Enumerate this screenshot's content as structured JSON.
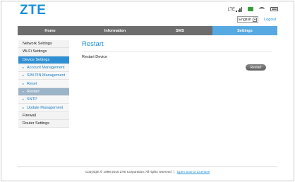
{
  "header": {
    "logo": "ZTE",
    "network_type": "LTE",
    "icons": [
      "signal-icon",
      "sms-icon",
      "wifi-icon",
      "battery-icon"
    ]
  },
  "lang": {
    "selected": "English",
    "logout": "Logout"
  },
  "nav": {
    "tabs": [
      {
        "label": "Home"
      },
      {
        "label": "Information"
      },
      {
        "label": "SMS"
      },
      {
        "label": "Settings"
      }
    ]
  },
  "sidebar": {
    "items": [
      {
        "label": "Network Settings"
      },
      {
        "label": "Wi-Fi Settings"
      },
      {
        "label": "Device Settings"
      },
      {
        "label": "Account Management"
      },
      {
        "label": "SIM PIN Management"
      },
      {
        "label": "Reset"
      },
      {
        "label": "Restart"
      },
      {
        "label": "SNTP"
      },
      {
        "label": "Update Management"
      },
      {
        "label": "Firewall"
      },
      {
        "label": "Router Settings"
      }
    ]
  },
  "main": {
    "title": "Restart",
    "section_label": "Restart Device",
    "restart_button": "Restart"
  },
  "footer": {
    "copyright": "Copyright © 1998-2015 ZTE Corporation. All rights reserved",
    "separator": "|",
    "link": "Open Source Licenses"
  },
  "colors": {
    "accent": "#1b8fd6",
    "nav_bg": "#6d6d6d",
    "nav_active": "#56a9e1",
    "sidebar_active": "#2f8fd4",
    "sidebar_selected": "#9cb4c8"
  }
}
